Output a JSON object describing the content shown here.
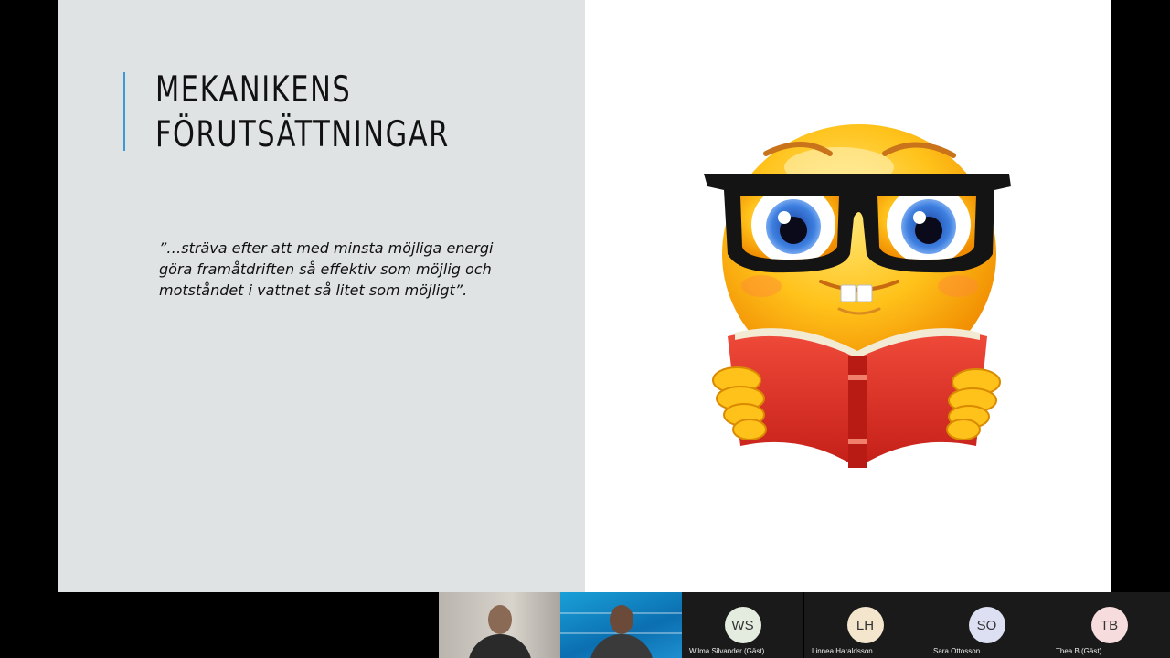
{
  "slide": {
    "title_line1": "MEKANIKENS",
    "title_line2": "FÖRUTSÄTTNINGAR",
    "quote_line1": "”…sträva efter att med minsta möjliga energi",
    "quote_line2": "göra framåtdriften så effektiv som möjlig och",
    "quote_line3": "motståndet i vattnet så litet som möjligt”.",
    "image_icon": "nerd-emoji-reading-book"
  },
  "colors": {
    "left_panel": "#dfe3e3",
    "accent": "#3a9ad9"
  },
  "participants": [
    {
      "initials": "WS",
      "name": "Wilma Silvander (Gäst)",
      "color": "#e4ece0"
    },
    {
      "initials": "LH",
      "name": "Linnea Haraldsson",
      "color": "#f3e6cc"
    },
    {
      "initials": "SO",
      "name": "Sara Ottosson",
      "color": "#dde0f2"
    },
    {
      "initials": "TB",
      "name": "Thea B (Gäst)",
      "color": "#f6dcdc"
    }
  ]
}
